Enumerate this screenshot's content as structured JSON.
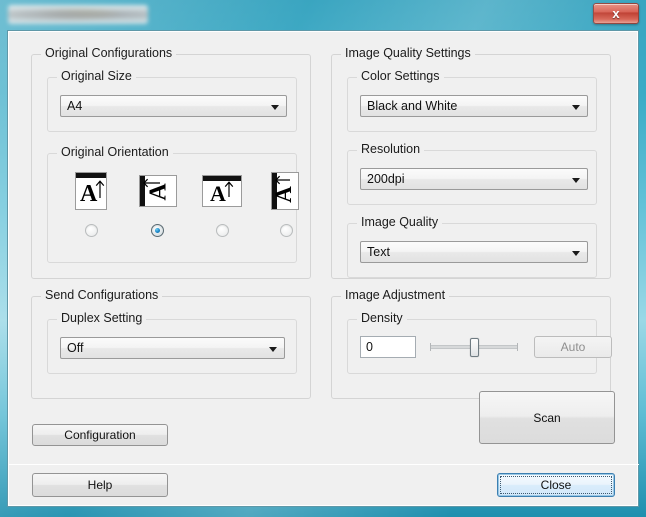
{
  "window": {
    "title": "",
    "title_redacted": true,
    "close_label": "x",
    "frame_color": "#4fb3cc",
    "client_bg": "#f0f0f0"
  },
  "original_configurations": {
    "label": "Original Configurations",
    "original_size": {
      "label": "Original Size",
      "value": "A4"
    },
    "original_orientation": {
      "label": "Original Orientation",
      "selected_index": 1,
      "options": [
        {
          "icon": "orientation-portrait-top-icon",
          "selected": false
        },
        {
          "icon": "orientation-landscape-left-icon",
          "selected": true
        },
        {
          "icon": "orientation-wide-top-icon",
          "selected": false
        },
        {
          "icon": "orientation-tall-left-icon",
          "selected": false
        }
      ]
    }
  },
  "send_configurations": {
    "label": "Send Configurations",
    "duplex_setting": {
      "label": "Duplex Setting",
      "value": "Off"
    }
  },
  "image_quality_settings": {
    "label": "Image Quality Settings",
    "color_settings": {
      "label": "Color Settings",
      "value": "Black and White"
    },
    "resolution": {
      "label": "Resolution",
      "value": "200dpi"
    },
    "image_quality": {
      "label": "Image Quality",
      "value": "Text"
    }
  },
  "image_adjustment": {
    "label": "Image Adjustment",
    "density": {
      "label": "Density",
      "value": "0",
      "slider_percent": 50,
      "auto_label": "Auto",
      "auto_disabled": true
    }
  },
  "actions": {
    "configuration_label": "Configuration",
    "scan_label": "Scan",
    "help_label": "Help",
    "close_label": "Close",
    "close_focused": true
  }
}
